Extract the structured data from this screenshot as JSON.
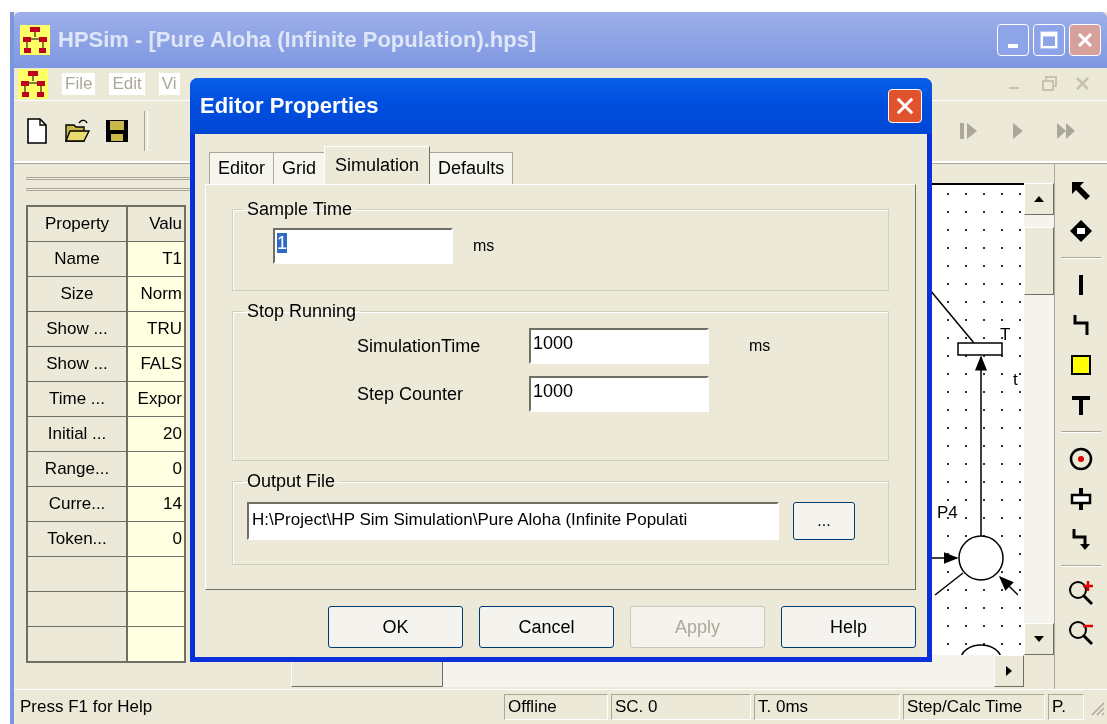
{
  "window": {
    "title": "HPSim - [Pure Aloha (Infinite Population).hps]"
  },
  "menu": [
    {
      "label": "File",
      "disabled": true
    },
    {
      "label": "Edit",
      "disabled": true
    },
    {
      "label": "Vi",
      "disabled": true
    }
  ],
  "property_grid": {
    "columns": [
      "Property",
      "Valu"
    ],
    "rows": [
      {
        "property": "Name",
        "value": "T1"
      },
      {
        "property": "Size",
        "value": "Norm"
      },
      {
        "property": "Show ...",
        "value": "TRU"
      },
      {
        "property": "Show ...",
        "value": "FALS"
      },
      {
        "property": "Time ...",
        "value": "Expor"
      },
      {
        "property": "Initial ...",
        "value": "20"
      },
      {
        "property": "Range...",
        "value": "0"
      },
      {
        "property": "Curre...",
        "value": "14"
      },
      {
        "property": "Token...",
        "value": "0"
      }
    ]
  },
  "canvas": {
    "labels": [
      {
        "text": "T",
        "kind": "transition"
      },
      {
        "text": "t",
        "kind": "note"
      },
      {
        "text": "P4",
        "kind": "place"
      }
    ]
  },
  "dialog": {
    "title": "Editor Properties",
    "tabs": [
      {
        "label": "Editor",
        "selected": false
      },
      {
        "label": "Grid",
        "selected": false
      },
      {
        "label": "Simulation",
        "selected": true
      },
      {
        "label": "Defaults",
        "selected": false
      }
    ],
    "sample_time": {
      "label": "Sample Time",
      "value": "1",
      "text_selected": true,
      "unit": "ms"
    },
    "stop_running": {
      "label": "Stop Running",
      "fields": [
        {
          "label": "SimulationTime",
          "value": "1000",
          "unit": "ms"
        },
        {
          "label": "Step Counter",
          "value": "1000"
        }
      ]
    },
    "output_file": {
      "label": "Output File",
      "value": "H:\\Project\\HP Sim Simulation\\Pure Aloha (Infinite Populati",
      "browse": "..."
    },
    "buttons": [
      {
        "label": "OK",
        "disabled": false
      },
      {
        "label": "Cancel",
        "disabled": false
      },
      {
        "label": "Apply",
        "disabled": true
      },
      {
        "label": "Help",
        "disabled": false
      }
    ]
  },
  "status_bar": [
    "Press F1 for Help",
    "Offline",
    "SC. 0",
    "T. 0ms",
    "Step/Calc Time",
    "P."
  ]
}
